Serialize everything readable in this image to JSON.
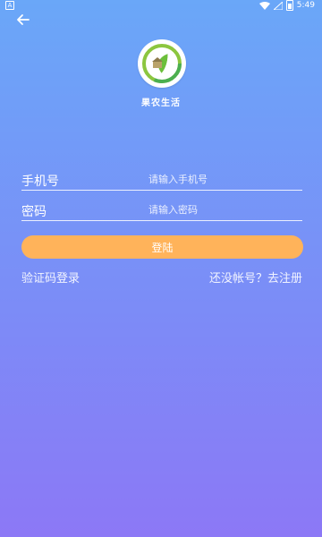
{
  "status_bar": {
    "left_indicator": "A",
    "time": "5:49"
  },
  "icons": {
    "back": "arrow-left-icon",
    "wifi": "wifi-icon",
    "signal": "signal-icon",
    "battery": "battery-icon",
    "logo": "leaf-logo-icon"
  },
  "app": {
    "name": "果农生活"
  },
  "form": {
    "phone": {
      "label": "手机号",
      "placeholder": "请输入手机号"
    },
    "password": {
      "label": "密码",
      "placeholder": "请输入密码"
    },
    "login_button": "登陆"
  },
  "links": {
    "sms_login": "验证码登录",
    "register": "还没帐号？去注册"
  },
  "colors": {
    "bg_top": "#6AA7F8",
    "bg_bottom": "#8C78F6",
    "button": "#FFB35A"
  }
}
